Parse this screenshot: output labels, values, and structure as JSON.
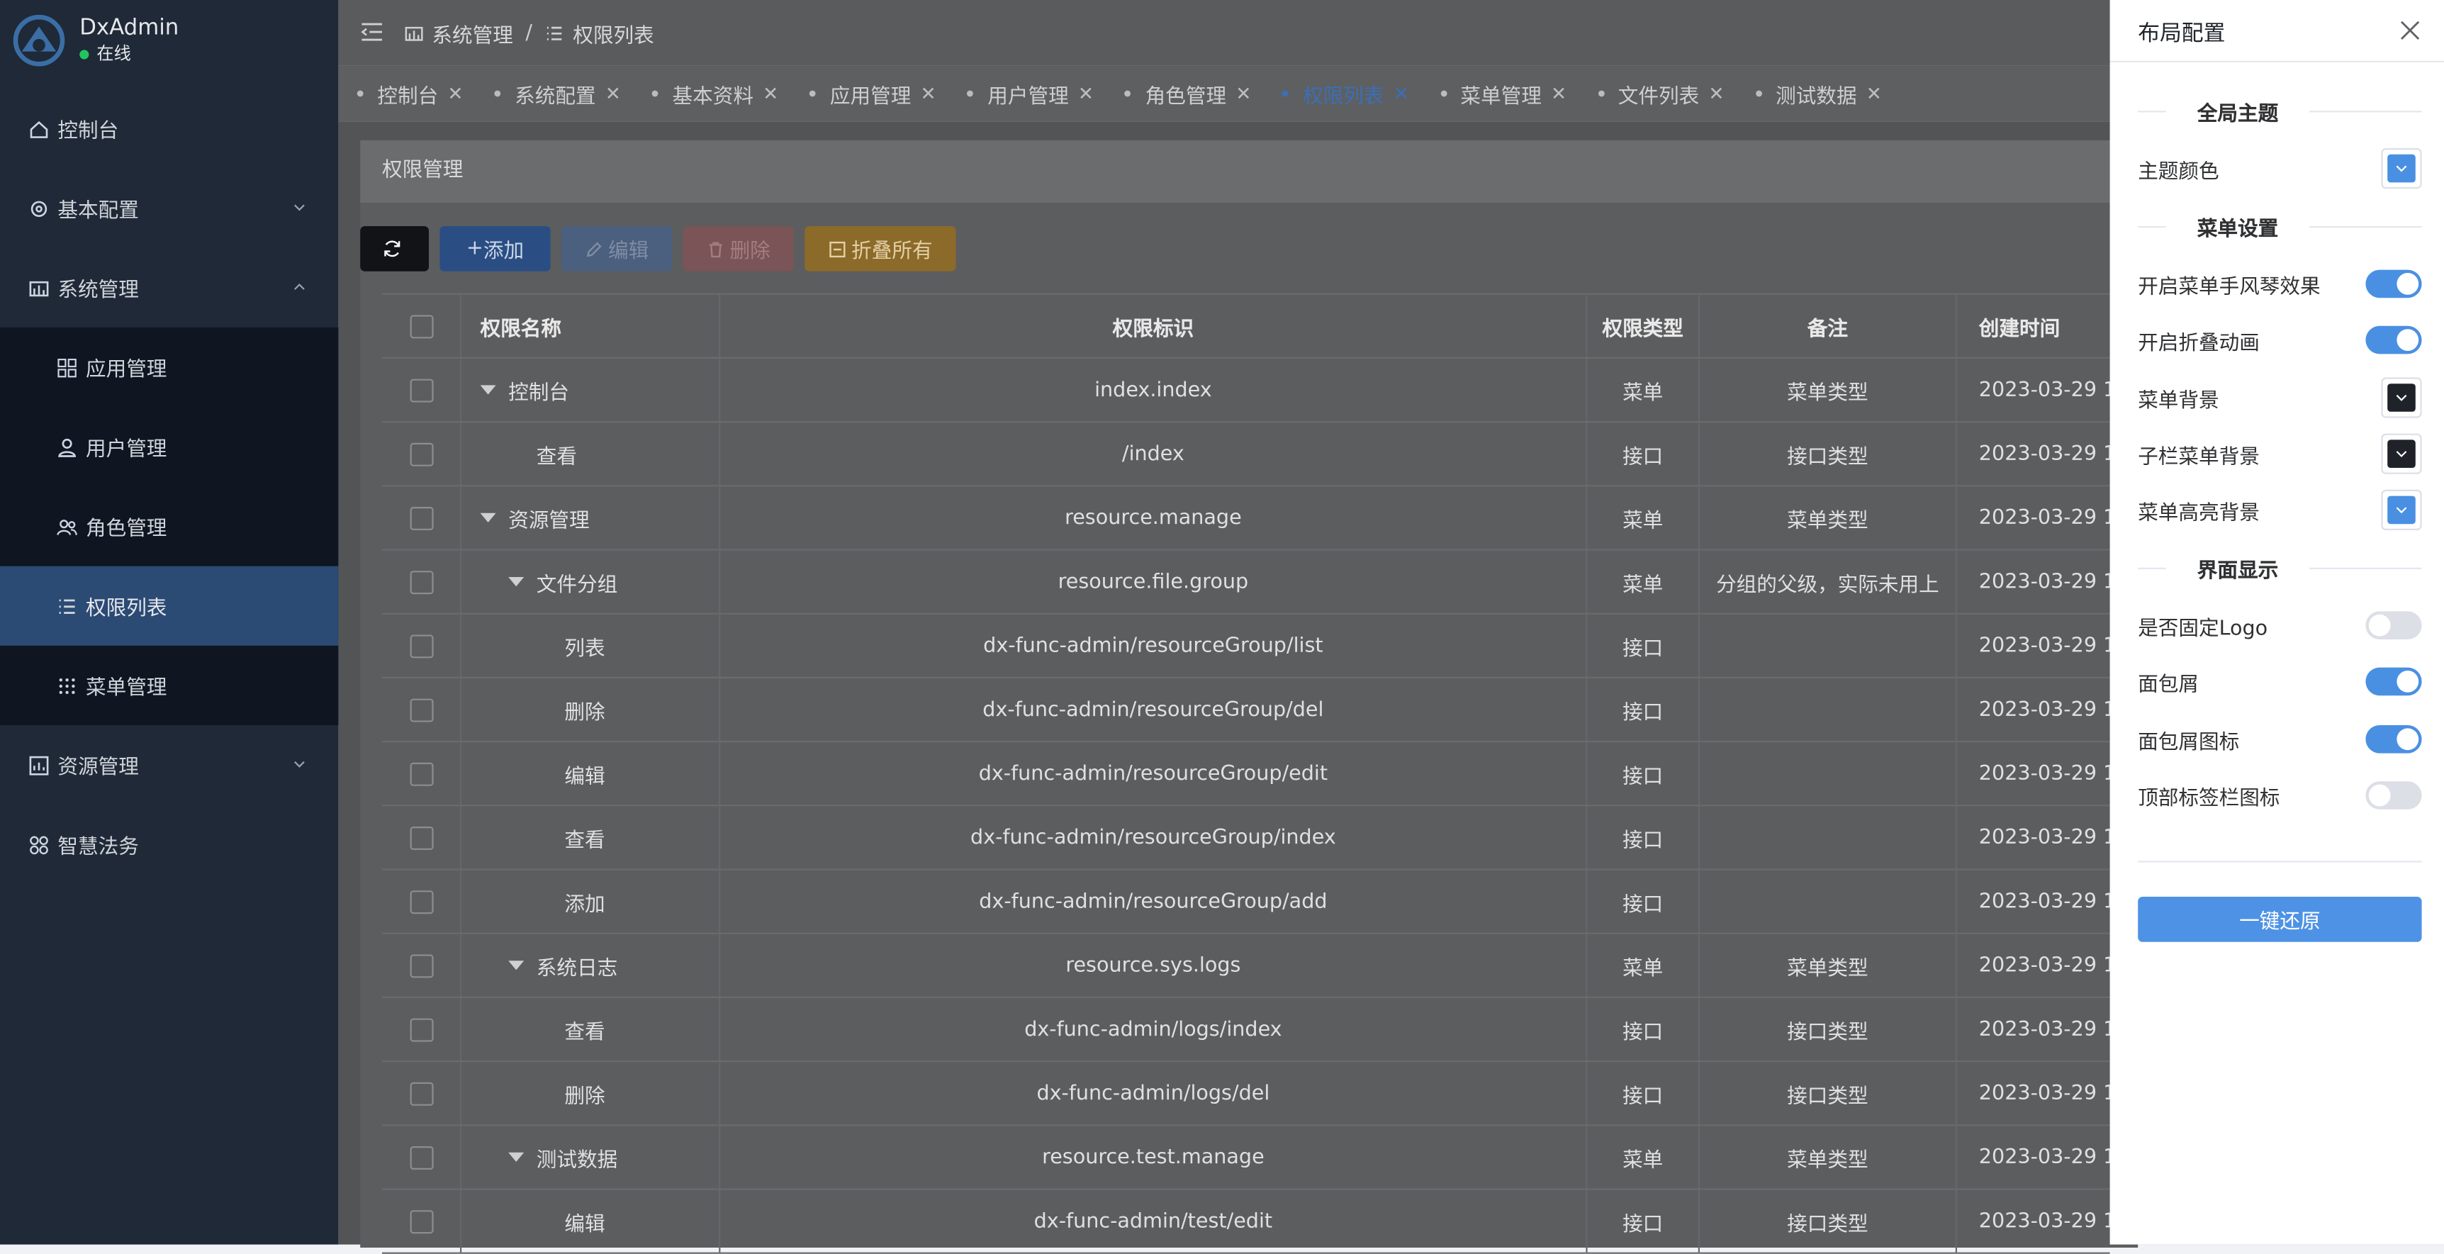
{
  "sidebar": {
    "app_name": "DxAdmin",
    "status": "在线",
    "menu": {
      "dashboard": "控制台",
      "basic_config": "基本配置",
      "system": "系统管理",
      "sub": {
        "apps": "应用管理",
        "users": "用户管理",
        "roles": "角色管理",
        "permissions": "权限列表",
        "menus": "菜单管理"
      },
      "resources": "资源管理",
      "smart_law": "智慧法务"
    }
  },
  "header": {
    "breadcrumb": [
      "系统管理",
      "/",
      "权限列表"
    ]
  },
  "tabs": [
    "控制台",
    "系统配置",
    "基本资料",
    "应用管理",
    "用户管理",
    "角色管理",
    "权限列表",
    "菜单管理",
    "文件列表",
    "测试数据"
  ],
  "active_tab": "权限列表",
  "main": {
    "title": "权限管理",
    "toolbar": {
      "add": "添加",
      "edit": "编辑",
      "delete": "删除",
      "collapse_all": "折叠所有"
    },
    "table": {
      "headers": [
        "权限名称",
        "权限标识",
        "权限类型",
        "备注",
        "创建时间"
      ],
      "rows": [
        {
          "name": "控制台",
          "level": 0,
          "expanded": true,
          "key": "index.index",
          "type": "菜单",
          "note": "菜单类型",
          "time": "2023-03-29 1"
        },
        {
          "name": "查看",
          "level": 1,
          "expanded": null,
          "key": "/index",
          "type": "接口",
          "note": "接口类型",
          "time": "2023-03-29 1"
        },
        {
          "name": "资源管理",
          "level": 0,
          "expanded": true,
          "key": "resource.manage",
          "type": "菜单",
          "note": "菜单类型",
          "time": "2023-03-29 1"
        },
        {
          "name": "文件分组",
          "level": 1,
          "expanded": true,
          "key": "resource.file.group",
          "type": "菜单",
          "note": "分组的父级，实际未用上",
          "time": "2023-03-29 1"
        },
        {
          "name": "列表",
          "level": 2,
          "expanded": null,
          "key": "dx-func-admin/resourceGroup/list",
          "type": "接口",
          "note": "",
          "time": "2023-03-29 1"
        },
        {
          "name": "删除",
          "level": 2,
          "expanded": null,
          "key": "dx-func-admin/resourceGroup/del",
          "type": "接口",
          "note": "",
          "time": "2023-03-29 1"
        },
        {
          "name": "编辑",
          "level": 2,
          "expanded": null,
          "key": "dx-func-admin/resourceGroup/edit",
          "type": "接口",
          "note": "",
          "time": "2023-03-29 1"
        },
        {
          "name": "查看",
          "level": 2,
          "expanded": null,
          "key": "dx-func-admin/resourceGroup/index",
          "type": "接口",
          "note": "",
          "time": "2023-03-29 1"
        },
        {
          "name": "添加",
          "level": 2,
          "expanded": null,
          "key": "dx-func-admin/resourceGroup/add",
          "type": "接口",
          "note": "",
          "time": "2023-03-29 1"
        },
        {
          "name": "系统日志",
          "level": 1,
          "expanded": true,
          "key": "resource.sys.logs",
          "type": "菜单",
          "note": "菜单类型",
          "time": "2023-03-29 1"
        },
        {
          "name": "查看",
          "level": 2,
          "expanded": null,
          "key": "dx-func-admin/logs/index",
          "type": "接口",
          "note": "接口类型",
          "time": "2023-03-29 1"
        },
        {
          "name": "删除",
          "level": 2,
          "expanded": null,
          "key": "dx-func-admin/logs/del",
          "type": "接口",
          "note": "接口类型",
          "time": "2023-03-29 1"
        },
        {
          "name": "测试数据",
          "level": 1,
          "expanded": true,
          "key": "resource.test.manage",
          "type": "菜单",
          "note": "菜单类型",
          "time": "2023-03-29 1"
        },
        {
          "name": "编辑",
          "level": 2,
          "expanded": null,
          "key": "dx-func-admin/test/edit",
          "type": "接口",
          "note": "接口类型",
          "time": "2023-03-29 1"
        }
      ]
    }
  },
  "drawer": {
    "title": "布局配置",
    "sections": {
      "global_theme": "全局主题",
      "menu_settings": "菜单设置",
      "display": "界面显示"
    },
    "settings": {
      "theme_color": {
        "label": "主题颜色",
        "color": "#4a90e2"
      },
      "accordion": {
        "label": "开启菜单手风琴效果",
        "on": true
      },
      "collapse_anim": {
        "label": "开启折叠动画",
        "on": true
      },
      "menu_bg": {
        "label": "菜单背景",
        "color": "#1f2329"
      },
      "submenu_bg": {
        "label": "子栏菜单背景",
        "color": "#1f2329"
      },
      "menu_highlight": {
        "label": "菜单高亮背景",
        "color": "#4a90e2"
      },
      "fixed_logo": {
        "label": "是否固定Logo",
        "on": false
      },
      "breadcrumb": {
        "label": "面包屑",
        "on": true
      },
      "breadcrumb_icon": {
        "label": "面包屑图标",
        "on": true
      },
      "tab_icon": {
        "label": "顶部标签栏图标",
        "on": false
      }
    },
    "reset": "一键还原"
  }
}
